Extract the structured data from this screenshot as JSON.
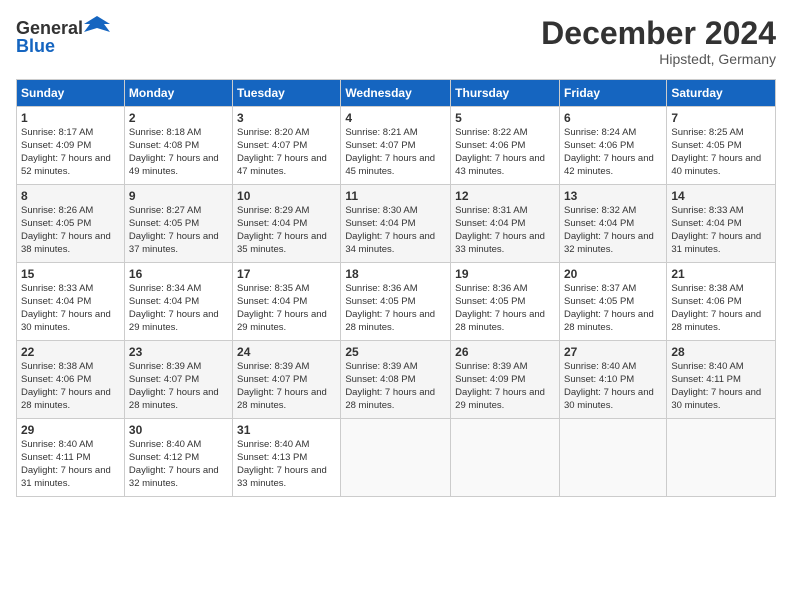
{
  "header": {
    "logo_general": "General",
    "logo_blue": "Blue",
    "month": "December 2024",
    "location": "Hipstedt, Germany"
  },
  "weekdays": [
    "Sunday",
    "Monday",
    "Tuesday",
    "Wednesday",
    "Thursday",
    "Friday",
    "Saturday"
  ],
  "weeks": [
    [
      {
        "day": "1",
        "sunrise": "Sunrise: 8:17 AM",
        "sunset": "Sunset: 4:09 PM",
        "daylight": "Daylight: 7 hours and 52 minutes."
      },
      {
        "day": "2",
        "sunrise": "Sunrise: 8:18 AM",
        "sunset": "Sunset: 4:08 PM",
        "daylight": "Daylight: 7 hours and 49 minutes."
      },
      {
        "day": "3",
        "sunrise": "Sunrise: 8:20 AM",
        "sunset": "Sunset: 4:07 PM",
        "daylight": "Daylight: 7 hours and 47 minutes."
      },
      {
        "day": "4",
        "sunrise": "Sunrise: 8:21 AM",
        "sunset": "Sunset: 4:07 PM",
        "daylight": "Daylight: 7 hours and 45 minutes."
      },
      {
        "day": "5",
        "sunrise": "Sunrise: 8:22 AM",
        "sunset": "Sunset: 4:06 PM",
        "daylight": "Daylight: 7 hours and 43 minutes."
      },
      {
        "day": "6",
        "sunrise": "Sunrise: 8:24 AM",
        "sunset": "Sunset: 4:06 PM",
        "daylight": "Daylight: 7 hours and 42 minutes."
      },
      {
        "day": "7",
        "sunrise": "Sunrise: 8:25 AM",
        "sunset": "Sunset: 4:05 PM",
        "daylight": "Daylight: 7 hours and 40 minutes."
      }
    ],
    [
      {
        "day": "8",
        "sunrise": "Sunrise: 8:26 AM",
        "sunset": "Sunset: 4:05 PM",
        "daylight": "Daylight: 7 hours and 38 minutes."
      },
      {
        "day": "9",
        "sunrise": "Sunrise: 8:27 AM",
        "sunset": "Sunset: 4:05 PM",
        "daylight": "Daylight: 7 hours and 37 minutes."
      },
      {
        "day": "10",
        "sunrise": "Sunrise: 8:29 AM",
        "sunset": "Sunset: 4:04 PM",
        "daylight": "Daylight: 7 hours and 35 minutes."
      },
      {
        "day": "11",
        "sunrise": "Sunrise: 8:30 AM",
        "sunset": "Sunset: 4:04 PM",
        "daylight": "Daylight: 7 hours and 34 minutes."
      },
      {
        "day": "12",
        "sunrise": "Sunrise: 8:31 AM",
        "sunset": "Sunset: 4:04 PM",
        "daylight": "Daylight: 7 hours and 33 minutes."
      },
      {
        "day": "13",
        "sunrise": "Sunrise: 8:32 AM",
        "sunset": "Sunset: 4:04 PM",
        "daylight": "Daylight: 7 hours and 32 minutes."
      },
      {
        "day": "14",
        "sunrise": "Sunrise: 8:33 AM",
        "sunset": "Sunset: 4:04 PM",
        "daylight": "Daylight: 7 hours and 31 minutes."
      }
    ],
    [
      {
        "day": "15",
        "sunrise": "Sunrise: 8:33 AM",
        "sunset": "Sunset: 4:04 PM",
        "daylight": "Daylight: 7 hours and 30 minutes."
      },
      {
        "day": "16",
        "sunrise": "Sunrise: 8:34 AM",
        "sunset": "Sunset: 4:04 PM",
        "daylight": "Daylight: 7 hours and 29 minutes."
      },
      {
        "day": "17",
        "sunrise": "Sunrise: 8:35 AM",
        "sunset": "Sunset: 4:04 PM",
        "daylight": "Daylight: 7 hours and 29 minutes."
      },
      {
        "day": "18",
        "sunrise": "Sunrise: 8:36 AM",
        "sunset": "Sunset: 4:05 PM",
        "daylight": "Daylight: 7 hours and 28 minutes."
      },
      {
        "day": "19",
        "sunrise": "Sunrise: 8:36 AM",
        "sunset": "Sunset: 4:05 PM",
        "daylight": "Daylight: 7 hours and 28 minutes."
      },
      {
        "day": "20",
        "sunrise": "Sunrise: 8:37 AM",
        "sunset": "Sunset: 4:05 PM",
        "daylight": "Daylight: 7 hours and 28 minutes."
      },
      {
        "day": "21",
        "sunrise": "Sunrise: 8:38 AM",
        "sunset": "Sunset: 4:06 PM",
        "daylight": "Daylight: 7 hours and 28 minutes."
      }
    ],
    [
      {
        "day": "22",
        "sunrise": "Sunrise: 8:38 AM",
        "sunset": "Sunset: 4:06 PM",
        "daylight": "Daylight: 7 hours and 28 minutes."
      },
      {
        "day": "23",
        "sunrise": "Sunrise: 8:39 AM",
        "sunset": "Sunset: 4:07 PM",
        "daylight": "Daylight: 7 hours and 28 minutes."
      },
      {
        "day": "24",
        "sunrise": "Sunrise: 8:39 AM",
        "sunset": "Sunset: 4:07 PM",
        "daylight": "Daylight: 7 hours and 28 minutes."
      },
      {
        "day": "25",
        "sunrise": "Sunrise: 8:39 AM",
        "sunset": "Sunset: 4:08 PM",
        "daylight": "Daylight: 7 hours and 28 minutes."
      },
      {
        "day": "26",
        "sunrise": "Sunrise: 8:39 AM",
        "sunset": "Sunset: 4:09 PM",
        "daylight": "Daylight: 7 hours and 29 minutes."
      },
      {
        "day": "27",
        "sunrise": "Sunrise: 8:40 AM",
        "sunset": "Sunset: 4:10 PM",
        "daylight": "Daylight: 7 hours and 30 minutes."
      },
      {
        "day": "28",
        "sunrise": "Sunrise: 8:40 AM",
        "sunset": "Sunset: 4:11 PM",
        "daylight": "Daylight: 7 hours and 30 minutes."
      }
    ],
    [
      {
        "day": "29",
        "sunrise": "Sunrise: 8:40 AM",
        "sunset": "Sunset: 4:11 PM",
        "daylight": "Daylight: 7 hours and 31 minutes."
      },
      {
        "day": "30",
        "sunrise": "Sunrise: 8:40 AM",
        "sunset": "Sunset: 4:12 PM",
        "daylight": "Daylight: 7 hours and 32 minutes."
      },
      {
        "day": "31",
        "sunrise": "Sunrise: 8:40 AM",
        "sunset": "Sunset: 4:13 PM",
        "daylight": "Daylight: 7 hours and 33 minutes."
      },
      null,
      null,
      null,
      null
    ]
  ]
}
